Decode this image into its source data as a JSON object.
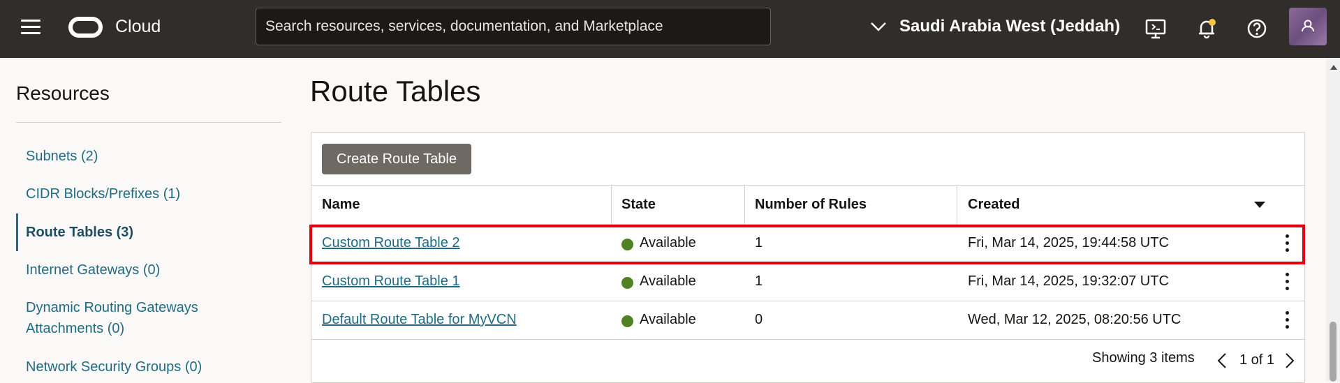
{
  "header": {
    "brand": "Cloud",
    "search_placeholder": "Search resources, services, documentation, and Marketplace",
    "region": "Saudi Arabia West (Jeddah)",
    "icons": [
      "hamburger-icon",
      "oracle-logo",
      "chevron-down-icon",
      "cloud-shell-icon",
      "bell-icon",
      "help-icon",
      "user-avatar-icon"
    ]
  },
  "sidebar": {
    "title": "Resources",
    "items": [
      {
        "label": "Subnets (2)"
      },
      {
        "label": "CIDR Blocks/Prefixes (1)"
      },
      {
        "label": "Route Tables (3)",
        "active": true
      },
      {
        "label": "Internet Gateways (0)"
      },
      {
        "label": "Dynamic Routing Gateways Attachments (0)"
      },
      {
        "label": "Network Security Groups (0)"
      }
    ]
  },
  "main": {
    "title": "Route Tables",
    "create_button": "Create Route Table",
    "table": {
      "columns": [
        "Name",
        "State",
        "Number of Rules",
        "Created"
      ],
      "rows": [
        {
          "name": "Custom Route Table 2",
          "state": "Available",
          "rules": "1",
          "created": "Fri, Mar 14, 2025, 19:44:58 UTC",
          "highlighted": true
        },
        {
          "name": "Custom Route Table 1",
          "state": "Available",
          "rules": "1",
          "created": "Fri, Mar 14, 2025, 19:32:07 UTC"
        },
        {
          "name": "Default Route Table for MyVCN",
          "state": "Available",
          "rules": "0",
          "created": "Wed, Mar 12, 2025, 08:20:56 UTC"
        }
      ]
    },
    "footer": {
      "showing": "Showing 3 items",
      "page": "1 of 1"
    }
  },
  "colors": {
    "topbar": "#312d2a",
    "link": "#1f6b84",
    "status_available": "#508223",
    "highlight": "#e0000f",
    "button": "#6f6964"
  }
}
